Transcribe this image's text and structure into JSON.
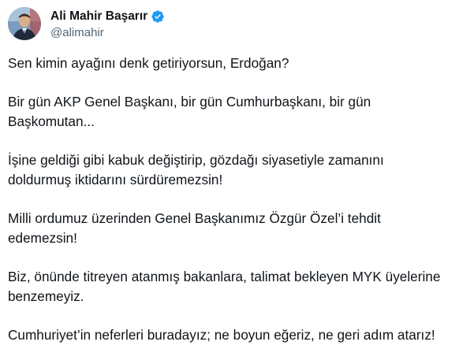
{
  "author": {
    "display_name": "Ali Mahir Başarır",
    "handle": "@alimahir",
    "verified_icon": "verified-badge-icon",
    "verified_color": "#1d9bf0",
    "avatar": "profile-photo"
  },
  "tweet": {
    "paragraphs": [
      {
        "lines": [
          "Sen kimin ayağını denk getiriyorsun, Erdoğan?"
        ]
      },
      {
        "lines": [
          "Bir gün AKP Genel Başkanı, bir gün Cumhurbaşkanı, bir gün",
          "Başkomutan..."
        ]
      },
      {
        "lines": [
          "İşine geldiği gibi kabuk değiştirip, gözdağı siyasetiyle zamanını",
          "doldurmuş iktidarını sürdüremezsin!"
        ]
      },
      {
        "lines": [
          "Milli ordumuz üzerinden Genel Başkanımız Özgür Özel’i tehdit",
          "edemezsin!"
        ]
      },
      {
        "lines": [
          "Biz, önünde titreyen atanmış bakanlara, talimat bekleyen MYK üyelerine",
          "benzemeyiz."
        ]
      },
      {
        "lines": [
          "Cumhuriyet’in neferleri buradayız; ne boyun eğeriz, ne geri adım atarız!"
        ]
      }
    ]
  }
}
